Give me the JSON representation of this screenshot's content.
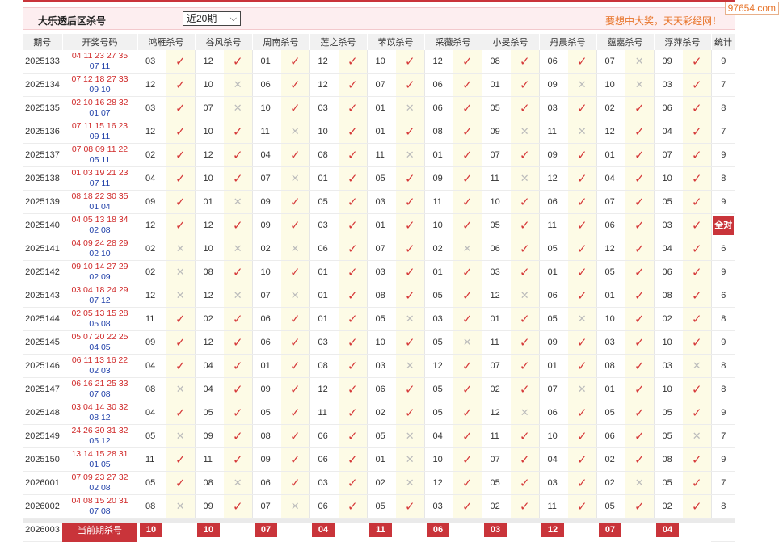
{
  "header": {
    "title": "大乐透后区杀号",
    "range_selected": "近20期",
    "slogan": "要想中大奖，天天彩经网！",
    "watermark": "97654.com"
  },
  "columns": {
    "issue": "期号",
    "draw": "开奖号码",
    "experts": [
      "鸿雁杀号",
      "谷风杀号",
      "周南杀号",
      "莲之杀号",
      "芣苡杀号",
      "采薇杀号",
      "小旻杀号",
      "丹晨杀号",
      "蕴嘉杀号",
      "浮萍杀号"
    ],
    "stats": "统计"
  },
  "rows": [
    {
      "issue": "2025133",
      "front": "04 11 23 27 35",
      "back": "07 11",
      "picks": [
        "03",
        "12",
        "01",
        "12",
        "10",
        "12",
        "08",
        "06",
        "07",
        "09"
      ],
      "hits": [
        1,
        1,
        1,
        1,
        1,
        1,
        1,
        1,
        0,
        1
      ],
      "total": "9"
    },
    {
      "issue": "2025134",
      "front": "07 12 18 27 33",
      "back": "09 10",
      "picks": [
        "12",
        "10",
        "06",
        "12",
        "07",
        "06",
        "01",
        "09",
        "10",
        "03"
      ],
      "hits": [
        1,
        0,
        1,
        1,
        1,
        1,
        1,
        0,
        0,
        1
      ],
      "total": "7"
    },
    {
      "issue": "2025135",
      "front": "02 10 16 28 32",
      "back": "01 07",
      "picks": [
        "03",
        "07",
        "10",
        "03",
        "01",
        "06",
        "05",
        "03",
        "02",
        "06"
      ],
      "hits": [
        1,
        0,
        1,
        1,
        0,
        1,
        1,
        1,
        1,
        1
      ],
      "total": "8"
    },
    {
      "issue": "2025136",
      "front": "07 11 15 16 23",
      "back": "09 11",
      "picks": [
        "12",
        "10",
        "11",
        "10",
        "01",
        "08",
        "09",
        "11",
        "12",
        "04"
      ],
      "hits": [
        1,
        1,
        0,
        1,
        1,
        1,
        0,
        0,
        1,
        1
      ],
      "total": "7"
    },
    {
      "issue": "2025137",
      "front": "07 08 09 11 22",
      "back": "05 11",
      "picks": [
        "02",
        "12",
        "04",
        "08",
        "11",
        "01",
        "07",
        "09",
        "01",
        "07"
      ],
      "hits": [
        1,
        1,
        1,
        1,
        0,
        1,
        1,
        1,
        1,
        1
      ],
      "total": "9"
    },
    {
      "issue": "2025138",
      "front": "01 03 19 21 23",
      "back": "07 11",
      "picks": [
        "04",
        "10",
        "07",
        "01",
        "05",
        "09",
        "11",
        "12",
        "04",
        "10"
      ],
      "hits": [
        1,
        1,
        0,
        1,
        1,
        1,
        0,
        1,
        1,
        1
      ],
      "total": "8"
    },
    {
      "issue": "2025139",
      "front": "08 18 22 30 35",
      "back": "01 04",
      "picks": [
        "09",
        "01",
        "09",
        "05",
        "03",
        "11",
        "10",
        "06",
        "07",
        "05"
      ],
      "hits": [
        1,
        0,
        1,
        1,
        1,
        1,
        1,
        1,
        1,
        1
      ],
      "total": "9"
    },
    {
      "issue": "2025140",
      "front": "04 05 13 18 34",
      "back": "02 08",
      "picks": [
        "12",
        "12",
        "09",
        "03",
        "01",
        "10",
        "05",
        "11",
        "06",
        "03"
      ],
      "hits": [
        1,
        1,
        1,
        1,
        1,
        1,
        1,
        1,
        1,
        1
      ],
      "total": "全对"
    },
    {
      "issue": "2025141",
      "front": "04 09 24 28 29",
      "back": "02 10",
      "picks": [
        "02",
        "10",
        "02",
        "06",
        "07",
        "02",
        "06",
        "05",
        "12",
        "04"
      ],
      "hits": [
        0,
        0,
        0,
        1,
        1,
        0,
        1,
        1,
        1,
        1
      ],
      "total": "6"
    },
    {
      "issue": "2025142",
      "front": "09 10 14 27 29",
      "back": "02 09",
      "picks": [
        "02",
        "08",
        "10",
        "01",
        "03",
        "01",
        "03",
        "01",
        "05",
        "06"
      ],
      "hits": [
        0,
        1,
        1,
        1,
        1,
        1,
        1,
        1,
        1,
        1
      ],
      "total": "9"
    },
    {
      "issue": "2025143",
      "front": "03 04 18 24 29",
      "back": "07 12",
      "picks": [
        "12",
        "12",
        "07",
        "01",
        "08",
        "05",
        "12",
        "06",
        "01",
        "08"
      ],
      "hits": [
        0,
        0,
        0,
        1,
        1,
        1,
        0,
        1,
        1,
        1
      ],
      "total": "6"
    },
    {
      "issue": "2025144",
      "front": "02 05 13 15 28",
      "back": "05 08",
      "picks": [
        "11",
        "02",
        "06",
        "01",
        "05",
        "03",
        "01",
        "05",
        "10",
        "02"
      ],
      "hits": [
        1,
        1,
        1,
        1,
        0,
        1,
        1,
        0,
        1,
        1
      ],
      "total": "8"
    },
    {
      "issue": "2025145",
      "front": "05 07 20 22 25",
      "back": "04 05",
      "picks": [
        "09",
        "12",
        "06",
        "03",
        "10",
        "05",
        "11",
        "09",
        "03",
        "10"
      ],
      "hits": [
        1,
        1,
        1,
        1,
        1,
        0,
        1,
        1,
        1,
        1
      ],
      "total": "9"
    },
    {
      "issue": "2025146",
      "front": "06 11 13 16 22",
      "back": "02 03",
      "picks": [
        "04",
        "04",
        "01",
        "08",
        "03",
        "12",
        "07",
        "01",
        "08",
        "03"
      ],
      "hits": [
        1,
        1,
        1,
        1,
        0,
        1,
        1,
        1,
        1,
        0
      ],
      "total": "8"
    },
    {
      "issue": "2025147",
      "front": "06 16 21 25 33",
      "back": "07 08",
      "picks": [
        "08",
        "04",
        "09",
        "12",
        "06",
        "05",
        "02",
        "07",
        "01",
        "10"
      ],
      "hits": [
        0,
        1,
        1,
        1,
        1,
        1,
        1,
        0,
        1,
        1
      ],
      "total": "8"
    },
    {
      "issue": "2025148",
      "front": "03 04 14 30 32",
      "back": "08 12",
      "picks": [
        "04",
        "05",
        "05",
        "11",
        "02",
        "05",
        "12",
        "06",
        "05",
        "05"
      ],
      "hits": [
        1,
        1,
        1,
        1,
        1,
        1,
        0,
        1,
        1,
        1
      ],
      "total": "9"
    },
    {
      "issue": "2025149",
      "front": "24 26 30 31 32",
      "back": "05 12",
      "picks": [
        "05",
        "09",
        "08",
        "06",
        "05",
        "04",
        "11",
        "10",
        "06",
        "05"
      ],
      "hits": [
        0,
        1,
        1,
        1,
        0,
        1,
        1,
        1,
        1,
        0
      ],
      "total": "7"
    },
    {
      "issue": "2025150",
      "front": "13 14 15 28 31",
      "back": "01 05",
      "picks": [
        "11",
        "11",
        "09",
        "06",
        "01",
        "10",
        "07",
        "04",
        "02",
        "08"
      ],
      "hits": [
        1,
        1,
        1,
        1,
        0,
        1,
        1,
        1,
        1,
        1
      ],
      "total": "9"
    },
    {
      "issue": "2026001",
      "front": "07 09 23 27 32",
      "back": "02 08",
      "picks": [
        "05",
        "08",
        "06",
        "03",
        "02",
        "12",
        "05",
        "03",
        "02",
        "05"
      ],
      "hits": [
        1,
        0,
        1,
        1,
        0,
        1,
        1,
        1,
        0,
        1
      ],
      "total": "7"
    },
    {
      "issue": "2026002",
      "front": "04 08 15 20 31",
      "back": "07 08",
      "picks": [
        "08",
        "09",
        "07",
        "06",
        "05",
        "03",
        "02",
        "11",
        "05",
        "02"
      ],
      "hits": [
        0,
        1,
        0,
        1,
        1,
        1,
        1,
        1,
        1,
        1
      ],
      "total": "8"
    }
  ],
  "current": {
    "issue": "2026003",
    "label": "当前期杀号",
    "picks": [
      "10",
      "10",
      "07",
      "04",
      "11",
      "06",
      "03",
      "12",
      "07",
      "04"
    ]
  },
  "icons": {
    "hit": "check-icon",
    "miss": "cross-icon"
  },
  "colors": {
    "accent": "#c9343a",
    "front": "#d02a2a",
    "back": "#1f3fa8",
    "slogan": "#e8752b"
  }
}
